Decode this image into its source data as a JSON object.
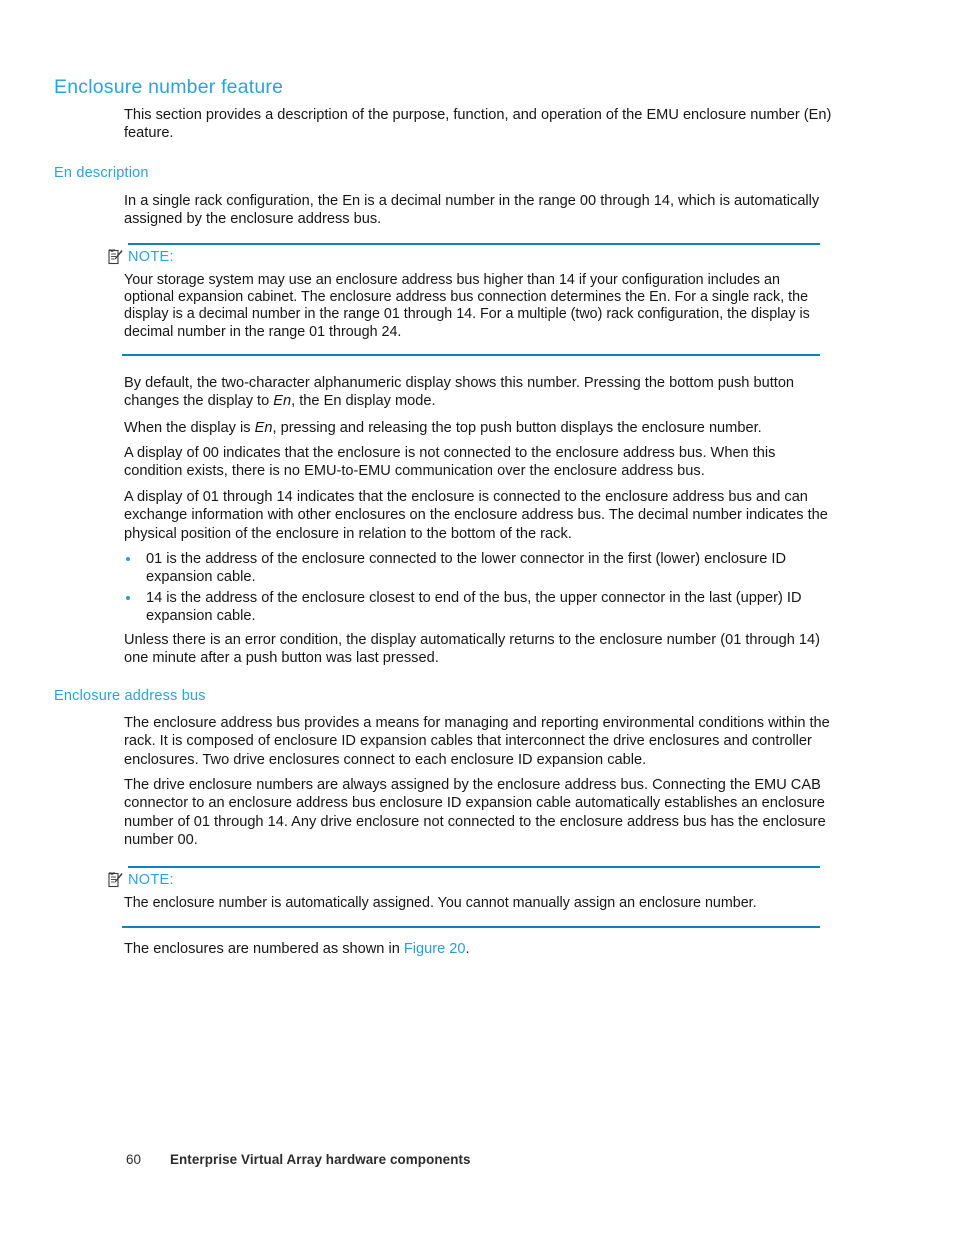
{
  "document": {
    "section_title": "Enclosure number feature",
    "intro_paragraph": "This section provides a description of the purpose, function, and operation of the EMU enclosure number (En) feature."
  },
  "en_description": {
    "heading": "En description",
    "paragraph_1": "In a single rack configuration, the En is a decimal number in the range 00 through 14, which is automatically assigned by the enclosure address bus.",
    "note": {
      "label": "NOTE:",
      "icon": "note-pencil-icon",
      "text": "Your storage system may use an enclosure address bus higher than 14 if your configuration includes an optional expansion cabinet. The enclosure address bus connection determines the En. For a single rack, the display is a decimal number in the range 01 through 14. For a multiple (two) rack configuration, the display is decimal number in the range 01 through 24."
    },
    "paragraph_2_a": "By default, the two-character alphanumeric display shows this number. Pressing the bottom push button changes the display to ",
    "paragraph_2_em": "En",
    "paragraph_2_b": ", the En display mode.",
    "paragraph_3_a": "When the display is ",
    "paragraph_3_em": "En",
    "paragraph_3_b": ", pressing and releasing the top push button displays the enclosure number.",
    "paragraph_4": "A display of 00 indicates that the enclosure is not connected to the enclosure address bus. When this condition exists, there is no EMU-to-EMU communication over the enclosure address bus.",
    "paragraph_5": "A display of 01 through 14 indicates that the enclosure is connected to the enclosure address bus and can exchange information with other enclosures on the enclosure address bus. The decimal number indicates the physical position of the enclosure in relation to the bottom of the rack.",
    "bullets": [
      "01 is the address of the enclosure connected to the lower connector in the first (lower) enclosure ID expansion cable.",
      "14 is the address of the enclosure closest to end of the bus, the upper connector in the last (upper) ID expansion cable."
    ],
    "paragraph_6": "Unless there is an error condition, the display automatically returns to the enclosure number (01 through 14) one minute after a push button was last pressed."
  },
  "enclosure_address_bus": {
    "heading": "Enclosure address bus",
    "paragraph_1": "The enclosure address bus provides a means for managing and reporting environmental conditions within the rack. It is composed of enclosure ID expansion cables that interconnect the drive enclosures and controller enclosures. Two drive enclosures connect to each enclosure ID expansion cable.",
    "paragraph_2": "The drive enclosure numbers are always assigned by the enclosure address bus. Connecting the EMU CAB connector to an enclosure address bus enclosure ID expansion cable automatically establishes an enclosure number of 01 through 14. Any drive enclosure not connected to the enclosure address bus has the enclosure number 00.",
    "note": {
      "label": "NOTE:",
      "icon": "note-pencil-icon",
      "text": "The enclosure number is automatically assigned. You cannot manually assign an enclosure number."
    },
    "closing_prefix": "The enclosures are numbered as shown in ",
    "closing_link": "Figure 20",
    "closing_suffix": "."
  },
  "footer": {
    "page_number": "60",
    "title": "Enterprise Virtual Array hardware components"
  },
  "colors": {
    "heading_blue": "#29A3DC",
    "rule_blue": "#1380BE",
    "link_blue": "#2E9BD6",
    "body_text": "#161616"
  }
}
